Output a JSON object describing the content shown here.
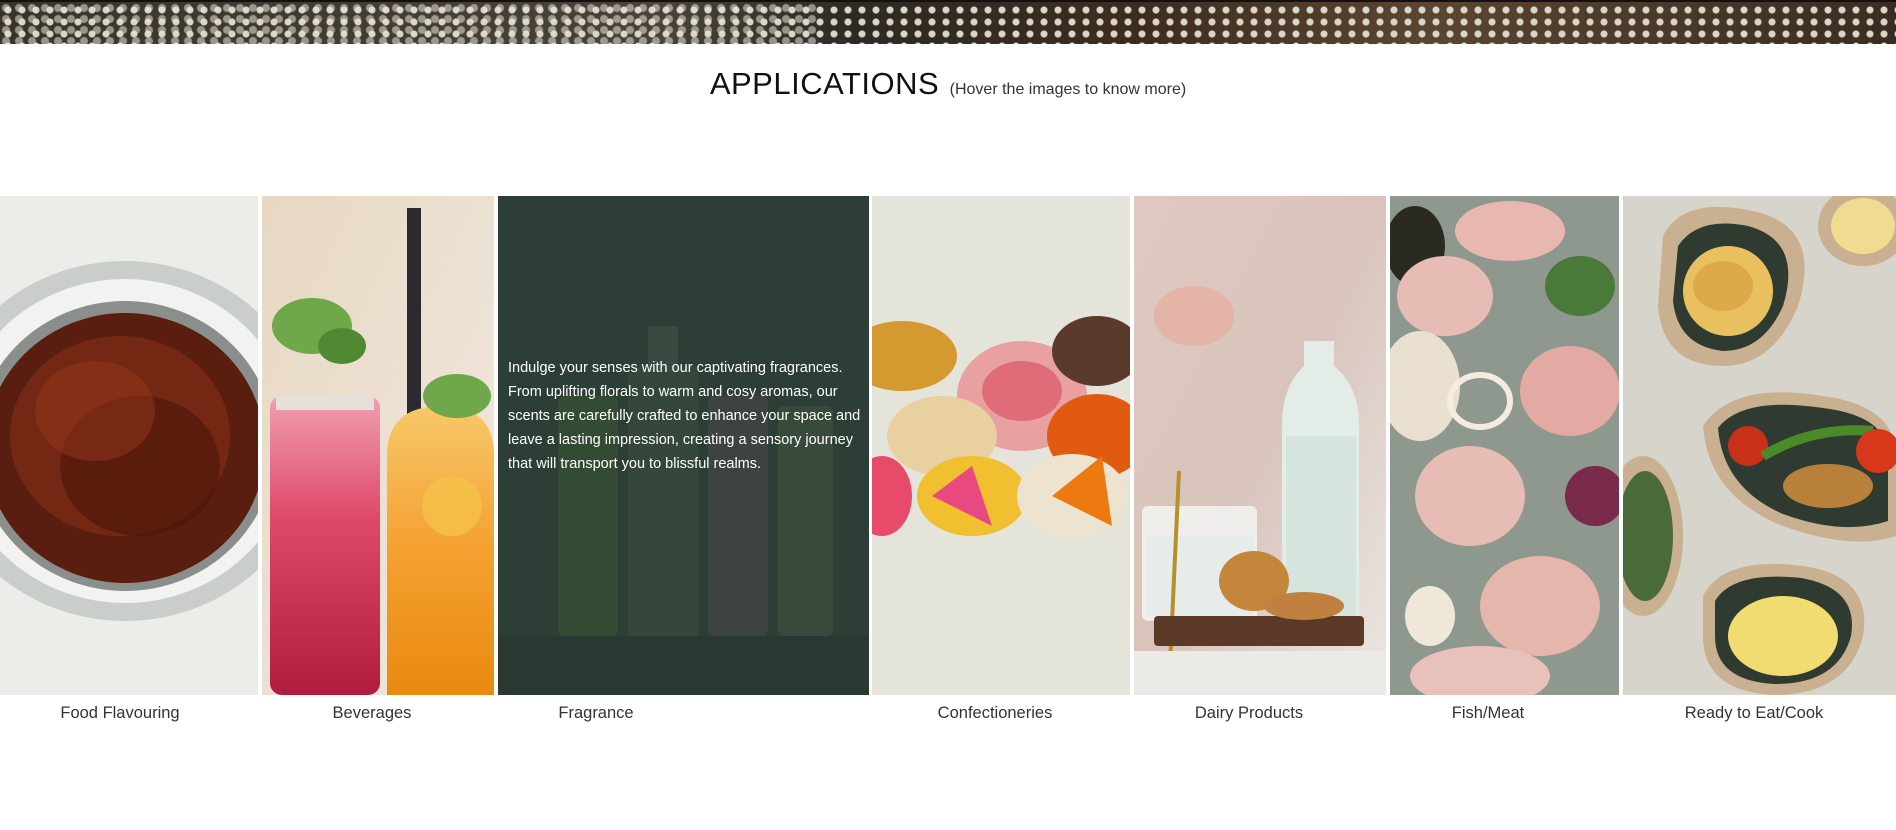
{
  "section": {
    "title": "APPLICATIONS",
    "hint": "(Hover the images to know more)"
  },
  "cards": [
    {
      "label": "Food Flavouring",
      "image": "food-flavouring-image"
    },
    {
      "label": "Beverages",
      "image": "beverages-image"
    },
    {
      "label": "Fragrance",
      "image": "fragrance-image",
      "description": "Indulge your senses with our captivating fragrances. From uplifting florals to warm and cosy aromas, our scents are carefully crafted to enhance your space and leave a lasting impression, creating a sensory journey that will transport you to blissful realms."
    },
    {
      "label": "Confectioneries",
      "image": "confectioneries-image"
    },
    {
      "label": "Dairy Products",
      "image": "dairy-products-image"
    },
    {
      "label": "Fish/Meat",
      "image": "fish-meat-image"
    },
    {
      "label": "Ready to Eat/Cook",
      "image": "ready-to-eat-cook-image"
    }
  ]
}
